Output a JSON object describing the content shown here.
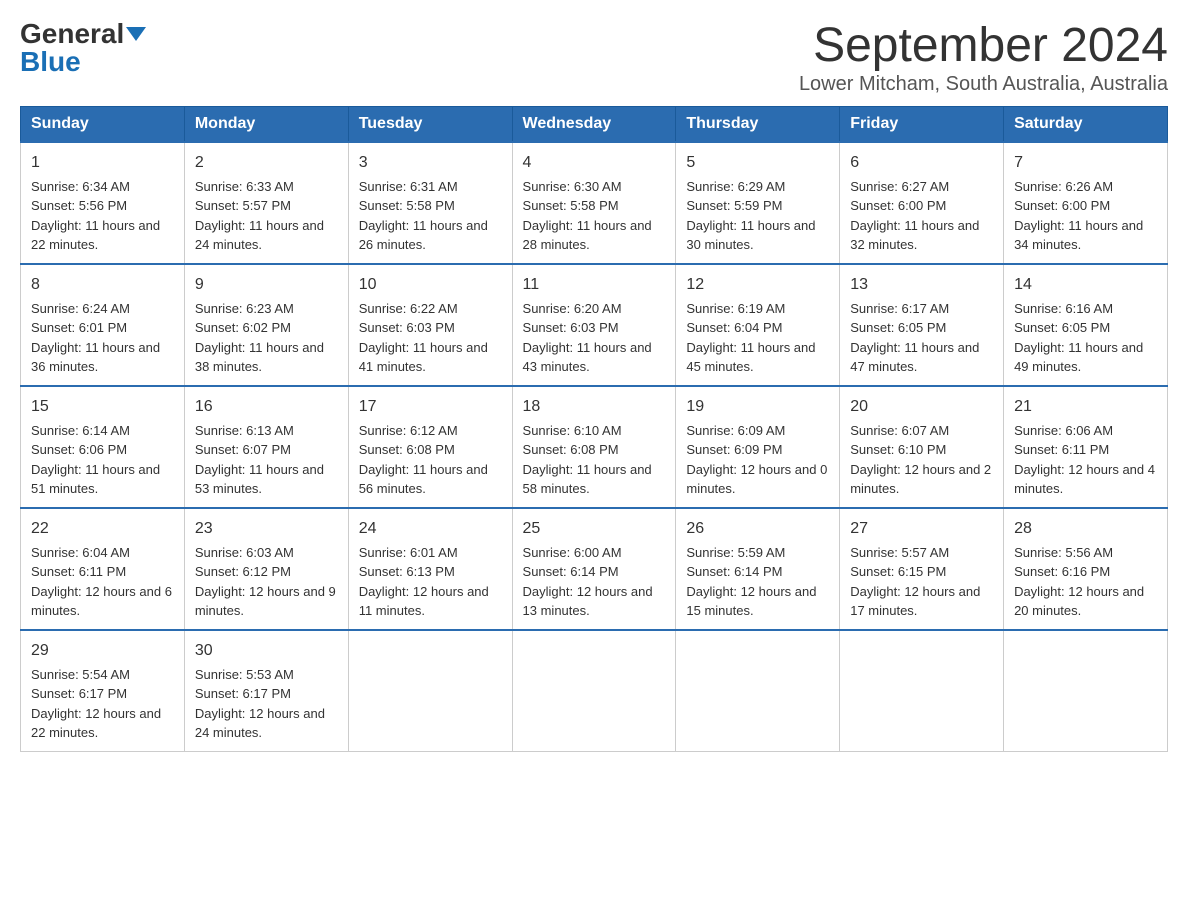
{
  "logo": {
    "general": "General",
    "blue": "Blue"
  },
  "title": "September 2024",
  "subtitle": "Lower Mitcham, South Australia, Australia",
  "headers": [
    "Sunday",
    "Monday",
    "Tuesday",
    "Wednesday",
    "Thursday",
    "Friday",
    "Saturday"
  ],
  "weeks": [
    [
      {
        "day": "1",
        "sunrise": "Sunrise: 6:34 AM",
        "sunset": "Sunset: 5:56 PM",
        "daylight": "Daylight: 11 hours and 22 minutes."
      },
      {
        "day": "2",
        "sunrise": "Sunrise: 6:33 AM",
        "sunset": "Sunset: 5:57 PM",
        "daylight": "Daylight: 11 hours and 24 minutes."
      },
      {
        "day": "3",
        "sunrise": "Sunrise: 6:31 AM",
        "sunset": "Sunset: 5:58 PM",
        "daylight": "Daylight: 11 hours and 26 minutes."
      },
      {
        "day": "4",
        "sunrise": "Sunrise: 6:30 AM",
        "sunset": "Sunset: 5:58 PM",
        "daylight": "Daylight: 11 hours and 28 minutes."
      },
      {
        "day": "5",
        "sunrise": "Sunrise: 6:29 AM",
        "sunset": "Sunset: 5:59 PM",
        "daylight": "Daylight: 11 hours and 30 minutes."
      },
      {
        "day": "6",
        "sunrise": "Sunrise: 6:27 AM",
        "sunset": "Sunset: 6:00 PM",
        "daylight": "Daylight: 11 hours and 32 minutes."
      },
      {
        "day": "7",
        "sunrise": "Sunrise: 6:26 AM",
        "sunset": "Sunset: 6:00 PM",
        "daylight": "Daylight: 11 hours and 34 minutes."
      }
    ],
    [
      {
        "day": "8",
        "sunrise": "Sunrise: 6:24 AM",
        "sunset": "Sunset: 6:01 PM",
        "daylight": "Daylight: 11 hours and 36 minutes."
      },
      {
        "day": "9",
        "sunrise": "Sunrise: 6:23 AM",
        "sunset": "Sunset: 6:02 PM",
        "daylight": "Daylight: 11 hours and 38 minutes."
      },
      {
        "day": "10",
        "sunrise": "Sunrise: 6:22 AM",
        "sunset": "Sunset: 6:03 PM",
        "daylight": "Daylight: 11 hours and 41 minutes."
      },
      {
        "day": "11",
        "sunrise": "Sunrise: 6:20 AM",
        "sunset": "Sunset: 6:03 PM",
        "daylight": "Daylight: 11 hours and 43 minutes."
      },
      {
        "day": "12",
        "sunrise": "Sunrise: 6:19 AM",
        "sunset": "Sunset: 6:04 PM",
        "daylight": "Daylight: 11 hours and 45 minutes."
      },
      {
        "day": "13",
        "sunrise": "Sunrise: 6:17 AM",
        "sunset": "Sunset: 6:05 PM",
        "daylight": "Daylight: 11 hours and 47 minutes."
      },
      {
        "day": "14",
        "sunrise": "Sunrise: 6:16 AM",
        "sunset": "Sunset: 6:05 PM",
        "daylight": "Daylight: 11 hours and 49 minutes."
      }
    ],
    [
      {
        "day": "15",
        "sunrise": "Sunrise: 6:14 AM",
        "sunset": "Sunset: 6:06 PM",
        "daylight": "Daylight: 11 hours and 51 minutes."
      },
      {
        "day": "16",
        "sunrise": "Sunrise: 6:13 AM",
        "sunset": "Sunset: 6:07 PM",
        "daylight": "Daylight: 11 hours and 53 minutes."
      },
      {
        "day": "17",
        "sunrise": "Sunrise: 6:12 AM",
        "sunset": "Sunset: 6:08 PM",
        "daylight": "Daylight: 11 hours and 56 minutes."
      },
      {
        "day": "18",
        "sunrise": "Sunrise: 6:10 AM",
        "sunset": "Sunset: 6:08 PM",
        "daylight": "Daylight: 11 hours and 58 minutes."
      },
      {
        "day": "19",
        "sunrise": "Sunrise: 6:09 AM",
        "sunset": "Sunset: 6:09 PM",
        "daylight": "Daylight: 12 hours and 0 minutes."
      },
      {
        "day": "20",
        "sunrise": "Sunrise: 6:07 AM",
        "sunset": "Sunset: 6:10 PM",
        "daylight": "Daylight: 12 hours and 2 minutes."
      },
      {
        "day": "21",
        "sunrise": "Sunrise: 6:06 AM",
        "sunset": "Sunset: 6:11 PM",
        "daylight": "Daylight: 12 hours and 4 minutes."
      }
    ],
    [
      {
        "day": "22",
        "sunrise": "Sunrise: 6:04 AM",
        "sunset": "Sunset: 6:11 PM",
        "daylight": "Daylight: 12 hours and 6 minutes."
      },
      {
        "day": "23",
        "sunrise": "Sunrise: 6:03 AM",
        "sunset": "Sunset: 6:12 PM",
        "daylight": "Daylight: 12 hours and 9 minutes."
      },
      {
        "day": "24",
        "sunrise": "Sunrise: 6:01 AM",
        "sunset": "Sunset: 6:13 PM",
        "daylight": "Daylight: 12 hours and 11 minutes."
      },
      {
        "day": "25",
        "sunrise": "Sunrise: 6:00 AM",
        "sunset": "Sunset: 6:14 PM",
        "daylight": "Daylight: 12 hours and 13 minutes."
      },
      {
        "day": "26",
        "sunrise": "Sunrise: 5:59 AM",
        "sunset": "Sunset: 6:14 PM",
        "daylight": "Daylight: 12 hours and 15 minutes."
      },
      {
        "day": "27",
        "sunrise": "Sunrise: 5:57 AM",
        "sunset": "Sunset: 6:15 PM",
        "daylight": "Daylight: 12 hours and 17 minutes."
      },
      {
        "day": "28",
        "sunrise": "Sunrise: 5:56 AM",
        "sunset": "Sunset: 6:16 PM",
        "daylight": "Daylight: 12 hours and 20 minutes."
      }
    ],
    [
      {
        "day": "29",
        "sunrise": "Sunrise: 5:54 AM",
        "sunset": "Sunset: 6:17 PM",
        "daylight": "Daylight: 12 hours and 22 minutes."
      },
      {
        "day": "30",
        "sunrise": "Sunrise: 5:53 AM",
        "sunset": "Sunset: 6:17 PM",
        "daylight": "Daylight: 12 hours and 24 minutes."
      },
      null,
      null,
      null,
      null,
      null
    ]
  ]
}
